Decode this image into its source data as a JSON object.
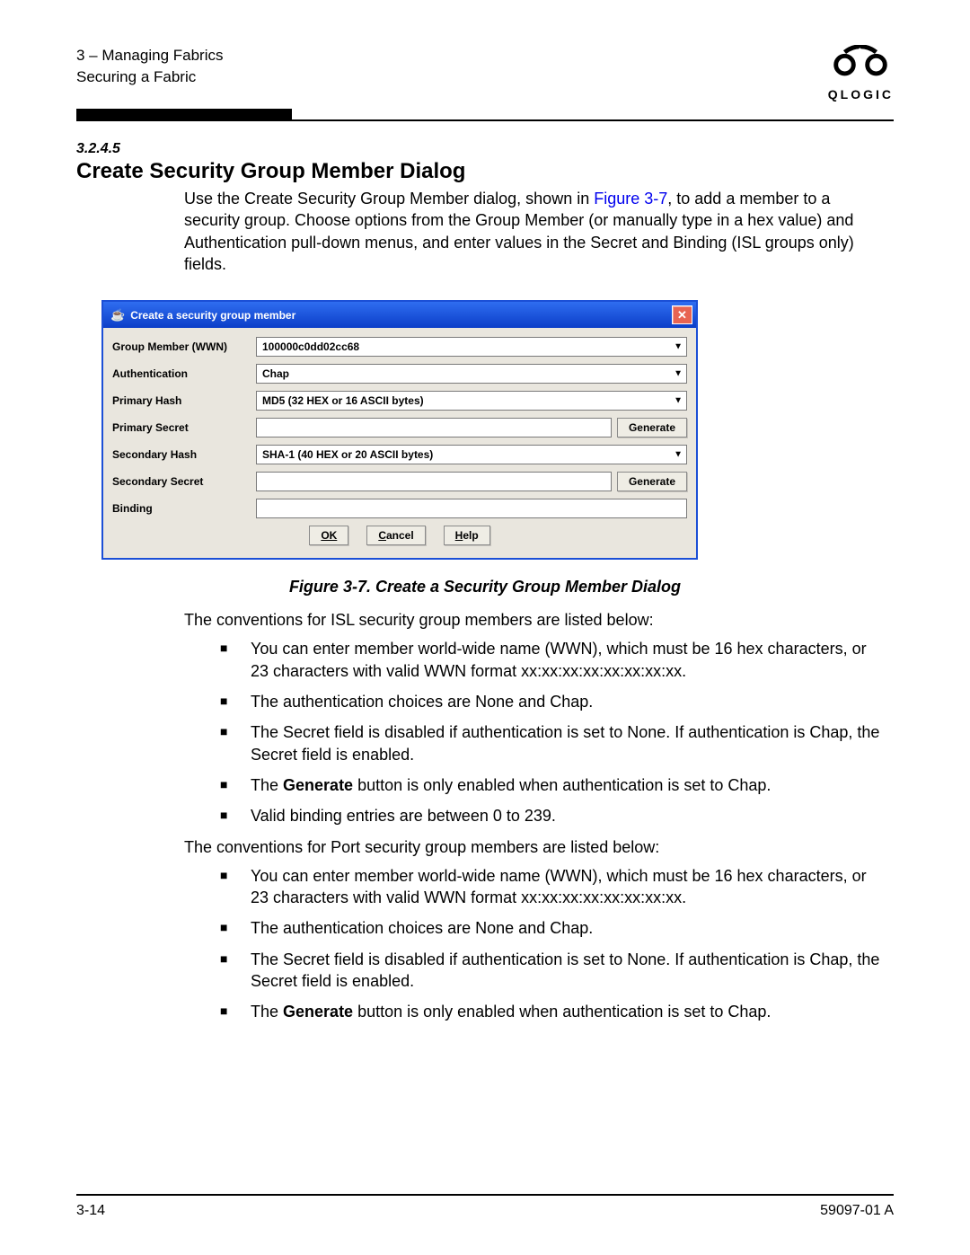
{
  "header": {
    "line1": "3 – Managing Fabrics",
    "line2": "Securing a Fabric",
    "brand": "QLOGIC"
  },
  "section": {
    "number": "3.2.4.5",
    "title": "Create Security Group Member Dialog",
    "intro_pre": "Use the Create Security Group Member dialog, shown in ",
    "intro_link": "Figure 3-7",
    "intro_post": ", to add a member to a security group. Choose options from the Group Member (or manually type in a hex value) and Authentication pull-down menus, and enter values in the Secret and Binding (ISL groups only) fields."
  },
  "dialog": {
    "title": "Create a security group member",
    "labels": {
      "group_member": "Group Member (WWN)",
      "authentication": "Authentication",
      "primary_hash": "Primary Hash",
      "primary_secret": "Primary Secret",
      "secondary_hash": "Secondary Hash",
      "secondary_secret": "Secondary Secret",
      "binding": "Binding"
    },
    "values": {
      "group_member": "100000c0dd02cc68",
      "authentication": "Chap",
      "primary_hash": "MD5 (32 HEX or 16 ASCII bytes)",
      "primary_secret": "",
      "secondary_hash": "SHA-1 (40 HEX or 20 ASCII bytes)",
      "secondary_secret": "",
      "binding": ""
    },
    "buttons": {
      "generate": "Generate",
      "ok": "OK",
      "cancel_u": "C",
      "cancel_rest": "ancel",
      "help_u": "H",
      "help_rest": "elp"
    }
  },
  "figure_caption": "Figure 3-7.  Create a Security Group Member Dialog",
  "isl_intro": "The conventions for ISL security group members are listed below:",
  "isl_items": [
    "You can enter member world-wide name (WWN), which must be 16 hex characters, or 23 characters with valid WWN format xx:xx:xx:xx:xx:xx:xx:xx.",
    "The authentication choices are None and Chap.",
    "The Secret field is disabled if authentication is set to None. If authentication is Chap, the Secret field is enabled.",
    "The |Generate| button is only enabled when authentication is set to Chap.",
    "Valid binding entries are between 0 to 239."
  ],
  "port_intro": "The conventions for Port security group members are listed below:",
  "port_items": [
    "You can enter member world-wide name (WWN), which must be 16 hex characters, or 23 characters with valid WWN format xx:xx:xx:xx:xx:xx:xx:xx.",
    "The authentication choices are None and Chap.",
    "The Secret field is disabled if authentication is set to None. If authentication is Chap, the Secret field is enabled.",
    "The |Generate| button is only enabled when authentication is set to Chap."
  ],
  "footer": {
    "left": "3-14",
    "right": "59097-01 A"
  }
}
